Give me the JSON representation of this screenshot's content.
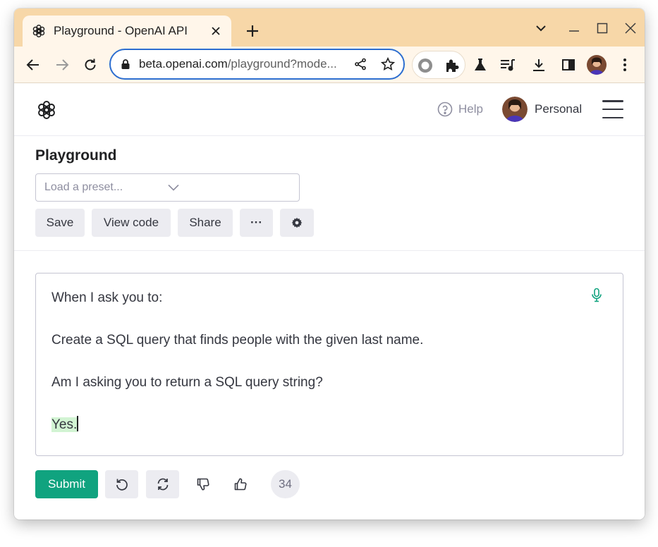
{
  "browser": {
    "tab": {
      "title": "Playground - OpenAI API",
      "favicon": "openai-logo-icon"
    },
    "address_bar": {
      "host": "beta.openai.com",
      "path": "/playground?mode..."
    },
    "colors": {
      "tabstrip": "#f7d7a8",
      "toolbar": "#fff6ea",
      "omnibox_border": "#2d6ed0"
    }
  },
  "header": {
    "help_label": "Help",
    "account_label": "Personal"
  },
  "playground": {
    "title": "Playground",
    "preset_placeholder": "Load a preset...",
    "buttons": {
      "save": "Save",
      "view_code": "View code",
      "share": "Share",
      "more": "···"
    }
  },
  "editor": {
    "lines": [
      "When I ask you to:",
      "Create a SQL query that finds people with the given last name.",
      "Am I asking you to return a SQL query string?"
    ],
    "completion": "Yes."
  },
  "actions": {
    "submit_label": "Submit",
    "token_count": "34"
  },
  "colors": {
    "accent": "#10a37f",
    "completion_highlight": "#d2f4d3"
  }
}
